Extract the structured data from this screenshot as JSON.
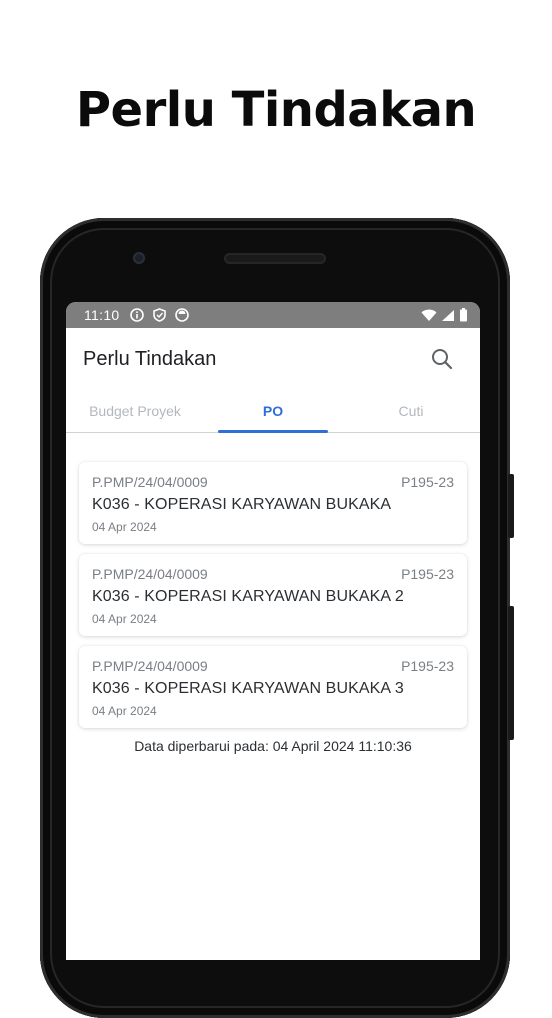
{
  "headline": "Perlu Tindakan",
  "status_bar": {
    "time": "11:10"
  },
  "app_bar": {
    "title": "Perlu Tindakan"
  },
  "tabs": [
    {
      "label": "Budget Proyek",
      "active": false
    },
    {
      "label": "PO",
      "active": true
    },
    {
      "label": "Cuti",
      "active": false
    }
  ],
  "items": [
    {
      "number": "P.PMP/24/04/0009",
      "code": "P195-23",
      "name": "K036 - KOPERASI KARYAWAN BUKAKA",
      "date": "04 Apr 2024"
    },
    {
      "number": "P.PMP/24/04/0009",
      "code": "P195-23",
      "name": "K036 - KOPERASI KARYAWAN BUKAKA 2",
      "date": "04 Apr 2024"
    },
    {
      "number": "P.PMP/24/04/0009",
      "code": "P195-23",
      "name": "K036 - KOPERASI KARYAWAN BUKAKA 3",
      "date": "04 Apr 2024"
    }
  ],
  "updated_text": "Data diperbarui pada: 04 April 2024 11:10:36",
  "colors": {
    "accent": "#2f6fd6",
    "status_bar": "#7e7e7e"
  },
  "icons": [
    "info-icon",
    "shield-icon",
    "notification-icon",
    "wifi-icon",
    "signal-icon",
    "battery-icon",
    "search-icon"
  ]
}
